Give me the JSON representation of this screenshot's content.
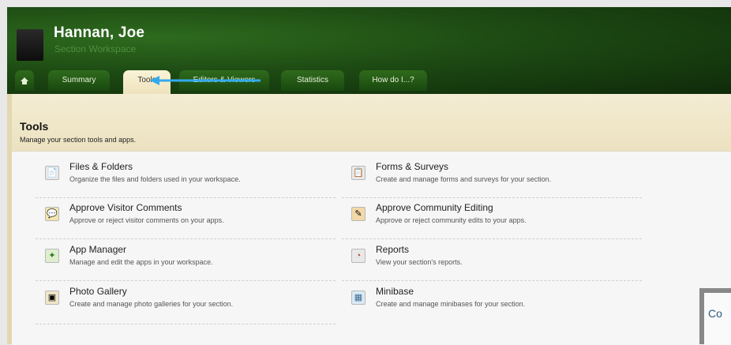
{
  "header": {
    "title": "Hannan, Joe",
    "subtitle": "Section Workspace"
  },
  "tabs": [
    {
      "label": "Summary",
      "active": false
    },
    {
      "label": "Tools",
      "active": true
    },
    {
      "label": "Editors & Viewers",
      "active": false
    },
    {
      "label": "Statistics",
      "active": false
    },
    {
      "label": "How do I...?",
      "active": false
    }
  ],
  "tools": {
    "title": "Tools",
    "subtitle": "Manage your section tools and apps."
  },
  "items": [
    {
      "name": "Files & Folders",
      "desc": "Organize the files and folders used in your workspace.",
      "icon": "files-folders-icon"
    },
    {
      "name": "Forms & Surveys",
      "desc": "Create and manage forms and surveys for your section.",
      "icon": "forms-surveys-icon"
    },
    {
      "name": "Approve Visitor Comments",
      "desc": "Approve or reject visitor comments on your apps.",
      "icon": "comments-icon"
    },
    {
      "name": "Approve Community Editing",
      "desc": "Approve or reject community edits to your apps.",
      "icon": "community-editing-icon"
    },
    {
      "name": "App Manager",
      "desc": "Manage and edit the apps in your workspace.",
      "icon": "app-manager-icon"
    },
    {
      "name": "Reports",
      "desc": "View your section's reports.",
      "icon": "reports-icon"
    },
    {
      "name": "Photo Gallery",
      "desc": "Create and manage photo galleries for your section.",
      "icon": "photo-gallery-icon"
    },
    {
      "name": "Minibase",
      "desc": "Create and manage minibases for your section.",
      "icon": "minibase-icon"
    }
  ],
  "corner_widget": {
    "label": "Co"
  },
  "colors": {
    "header_green": "#1d4a13",
    "tab_active": "#fbf3d8",
    "panel_tan": "#f1e9ce",
    "arrow_blue": "#33aaee",
    "corner_text": "#2a5a82"
  }
}
